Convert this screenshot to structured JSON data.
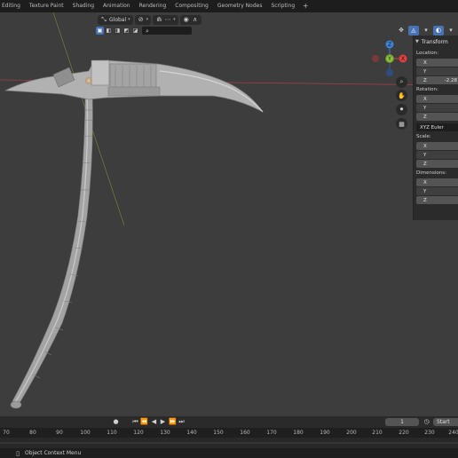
{
  "workspace_tabs": [
    "V Editing",
    "Texture Paint",
    "Shading",
    "Animation",
    "Rendering",
    "Compositing",
    "Geometry Nodes",
    "Scripting"
  ],
  "add_workspace_symbol": "+",
  "viewport_header": {
    "orientation_value": "Global",
    "icons": [
      "transform-orientation-icon",
      "pivot-icon",
      "snap-icon",
      "proportional-editing-icon",
      "falloff-icon"
    ]
  },
  "selection_modes": [
    "select-box-icon",
    "mode-icon-2",
    "mode-icon-3",
    "mode-icon-4",
    "mode-icon-5"
  ],
  "right_header_icons": [
    "show-gizmo-icon",
    "overlays-icon",
    "xray-icon",
    "shading-icon"
  ],
  "gizmo": {
    "x_label": "X",
    "y_label": "Y",
    "z_label": "Z",
    "x_color": "#e0413e",
    "y_color": "#8cbf3a",
    "z_color": "#3c83d8"
  },
  "nav_tools": [
    "zoom-icon",
    "pan-hand-icon",
    "camera-icon",
    "grid-icon"
  ],
  "transform_panel": {
    "title": "Transform",
    "location_label": "Location:",
    "location": {
      "x_label": "X",
      "y_label": "Y",
      "z_label": "Z",
      "x": "",
      "y": "",
      "z": "-2.28"
    },
    "rotation_label": "Rotation:",
    "rotation": {
      "x_label": "X",
      "y_label": "Y",
      "z_label": "Z"
    },
    "rotation_mode": "XYZ Euler",
    "scale_label": "Scale:",
    "scale": {
      "x_label": "X",
      "y_label": "Y",
      "z_label": "Z"
    },
    "dimensions_label": "Dimensions:",
    "dimensions": {
      "x_label": "X",
      "y_label": "Y",
      "z_label": "Z"
    }
  },
  "timeline": {
    "current_frame": "1",
    "start_label": "Start",
    "ruler_ticks": [
      "70",
      "80",
      "90",
      "100",
      "110",
      "120",
      "130",
      "140",
      "150",
      "160",
      "170",
      "180",
      "190",
      "200",
      "210",
      "220",
      "230",
      "240"
    ]
  },
  "status_bar": {
    "context_text": "Object Context Menu"
  },
  "colors": {
    "accent": "#4772b3",
    "viewport_bg": "#3d3d3d",
    "red_axis": "#b5454a",
    "green_axis": "#7ea03a"
  }
}
